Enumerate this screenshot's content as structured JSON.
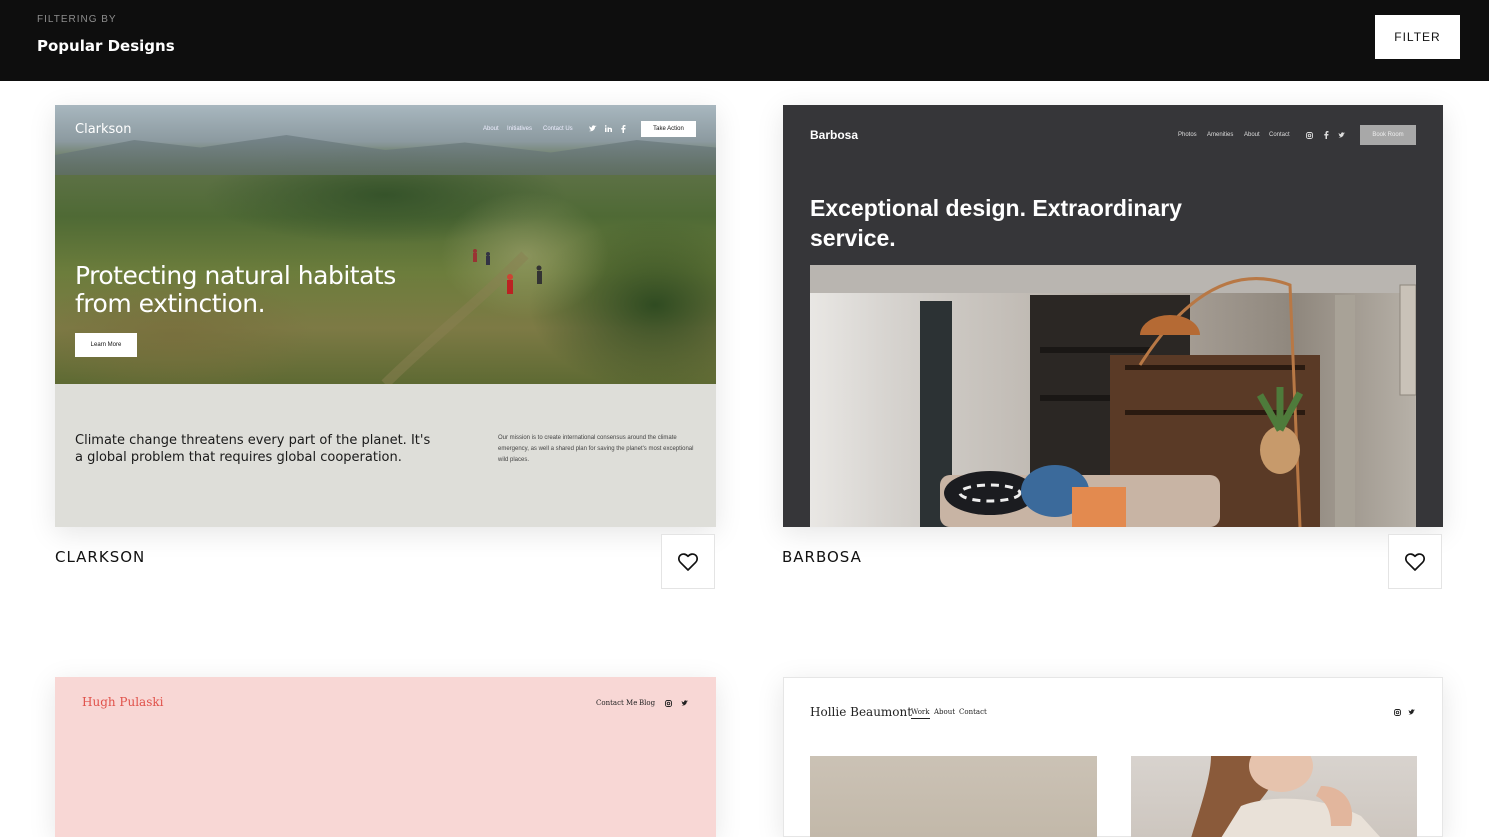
{
  "header": {
    "caption": "FILTERING BY",
    "value": "Popular Designs",
    "filter_label": "FILTER"
  },
  "templates": [
    {
      "name": "CLARKSON",
      "preview": {
        "logo": "Clarkson",
        "nav": [
          "About",
          "Initiatives",
          "Contact Us"
        ],
        "cta": "Take Action",
        "heading": "Protecting natural habitats from extinction.",
        "button": "Learn More",
        "statement": "Climate change threatens every part of the planet. It's a global problem that requires global cooperation.",
        "mission": "Our mission is to create international consensus around the climate emergency, as well a shared plan for saving the planet's most exceptional wild places."
      }
    },
    {
      "name": "BARBOSA",
      "preview": {
        "logo": "Barbosa",
        "nav": [
          "Photos",
          "Amenities",
          "About",
          "Contact"
        ],
        "cta": "Book Room",
        "heading": "Exceptional design. Extraordinary service."
      }
    },
    {
      "name": "HUGH PULASKI",
      "preview": {
        "logo": "Hugh Pulaski",
        "nav": [
          "Contact Me",
          "Blog"
        ]
      }
    },
    {
      "name": "HOLLIE BEAUMONT",
      "preview": {
        "logo": "Hollie Beaumont",
        "nav": [
          "Work",
          "About",
          "Contact"
        ]
      }
    }
  ],
  "colors": {
    "header_bg": "#0e0e0e",
    "clarkson_lower_bg": "#deded9",
    "barbosa_bg": "#363639",
    "hugh_bg": "#f8d7d5",
    "hugh_logo": "#e0514a"
  },
  "icons": [
    "heart-icon",
    "twitter-icon",
    "linkedin-icon",
    "facebook-icon",
    "instagram-icon"
  ]
}
